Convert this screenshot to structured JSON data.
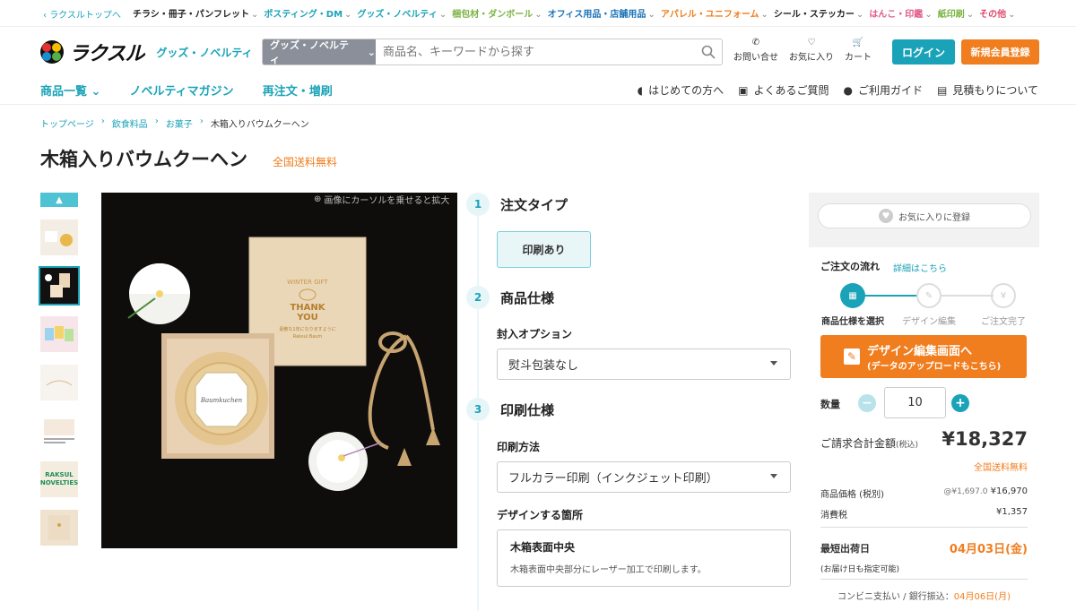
{
  "topbar": {
    "back": "ラクスルトップへ",
    "cats": [
      {
        "label": "チラシ・冊子・パンフレット",
        "color": "#222"
      },
      {
        "label": "ポスティング・DM",
        "color": "#1aa3b8"
      },
      {
        "label": "グッズ・ノベルティ",
        "color": "#1aa3b8"
      },
      {
        "label": "梱包材・ダンボール",
        "color": "#7cb342"
      },
      {
        "label": "オフィス用品・店舗用品",
        "color": "#1a73b8"
      },
      {
        "label": "アパレル・ユニフォーム",
        "color": "#f07d1e"
      },
      {
        "label": "シール・ステッカー",
        "color": "#222"
      },
      {
        "label": "はんこ・印鑑",
        "color": "#e05a8a"
      },
      {
        "label": "紙印刷",
        "color": "#7cb342"
      },
      {
        "label": "その他",
        "color": "#e04a6a"
      }
    ]
  },
  "header": {
    "logo": "ラクスル",
    "logo_sub": "グッズ・ノベルティ",
    "search_scope": "グッズ・ノベルティ",
    "search_placeholder": "商品名、キーワードから探す",
    "contact": "お問い合せ",
    "favorite": "お気に入り",
    "cart": "カート",
    "login": "ログイン",
    "register": "新規会員登録"
  },
  "nav": {
    "left": [
      "商品一覧",
      "ノベルティマガジン",
      "再注文・増刷"
    ],
    "right": [
      "はじめての方へ",
      "よくあるご質問",
      "ご利用ガイド",
      "見積もりについて"
    ]
  },
  "breadcrumb": [
    "トップページ",
    "飲食料品",
    "お菓子",
    "木箱入りバウムクーヘン"
  ],
  "product": {
    "title": "木箱入りバウムクーヘン",
    "shipping_free": "全国送料無料",
    "zoom_hint": "画像にカーソルを乗せると拡大",
    "box_text": [
      "WINTER GIFT",
      "THANK",
      "YOU",
      "素敵な1年になりますように",
      "Raksul Baum"
    ],
    "cake_label": "Baumkuchen",
    "thumb_labels": [
      "RAKSUL",
      "NOVELTIES"
    ]
  },
  "steps": {
    "s1": {
      "num": "1",
      "label": "注文タイプ",
      "option": "印刷あり"
    },
    "s2": {
      "num": "2",
      "label": "商品仕様",
      "sub": "封入オプション",
      "value": "熨斗包装なし"
    },
    "s3": {
      "num": "3",
      "label": "印刷仕様",
      "sub": "印刷方法",
      "value": "フルカラー印刷（インクジェット印刷）",
      "sub2": "デザインする箇所",
      "place": "木箱表面中央",
      "place_desc": "木箱表面中央部分にレーザー加工で印刷します。"
    }
  },
  "sidebar": {
    "favorite": "お気に入りに登録",
    "flow_title": "ご注文の流れ",
    "flow_link": "詳細はこちら",
    "flow_steps": [
      "商品仕様を選択",
      "デザイン編集",
      "ご注文完了"
    ],
    "design_btn": "デザイン編集画面へ",
    "design_sub": "(データのアップロードもこちら)",
    "qty_label": "数量",
    "qty": "10",
    "total_label": "ご請求合計金額",
    "total_tax": "(税込)",
    "total": "¥18,327",
    "total_ship": "全国送料無料",
    "price_label": "商品価格 (税別)",
    "unit_price": "@¥1,697.0",
    "price": "¥16,970",
    "tax_label": "消費税",
    "tax": "¥1,357",
    "ship_label": "最短出荷日",
    "ship_sub": "(お届け日も指定可能)",
    "ship_date": "04月03日(金)",
    "conv_label": "コンビニ支払い / 銀行振込：",
    "conv_date": "04月06日(月)"
  },
  "colors": {
    "accent": "#1aa3b8",
    "orange": "#f07d1e"
  }
}
